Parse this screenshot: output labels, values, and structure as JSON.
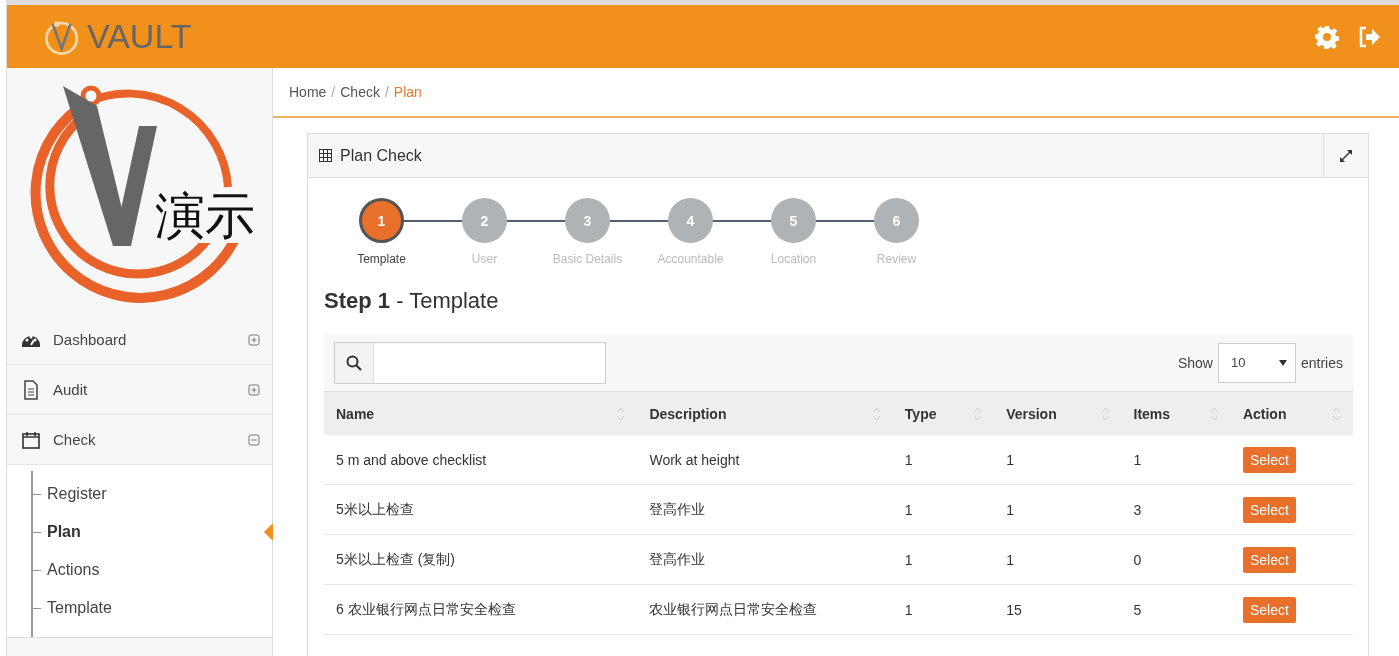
{
  "header": {
    "brand": "VAULT"
  },
  "sidebar": {
    "logo_text": "演示",
    "items": [
      {
        "label": "Dashboard",
        "expanded": false
      },
      {
        "label": "Audit",
        "expanded": false
      },
      {
        "label": "Check",
        "expanded": true,
        "children": [
          {
            "label": "Register",
            "selected": false
          },
          {
            "label": "Plan",
            "selected": true
          },
          {
            "label": "Actions",
            "selected": false
          },
          {
            "label": "Template",
            "selected": false
          }
        ]
      }
    ]
  },
  "breadcrumb": [
    {
      "label": "Home",
      "current": false
    },
    {
      "separator": "/",
      "label": "Check",
      "current": false
    },
    {
      "separator": "/",
      "label": "Plan",
      "current": true
    }
  ],
  "panel": {
    "title": "Plan Check",
    "steps": [
      {
        "number": "1",
        "label": "Template",
        "selected": true
      },
      {
        "number": "2",
        "label": "User",
        "selected": false
      },
      {
        "number": "3",
        "label": "Basic Details",
        "selected": false
      },
      {
        "number": "4",
        "label": "Accountable",
        "selected": false
      },
      {
        "number": "5",
        "label": "Location",
        "selected": false
      },
      {
        "number": "6",
        "label": "Review",
        "selected": false
      }
    ],
    "step_heading": "**Step 1** - Template",
    "show_label": "Show",
    "page_size": "10",
    "entries_label": "entries",
    "table": {
      "columns": [
        "Name",
        "Description",
        "Type",
        "Version",
        "Items",
        "Action"
      ],
      "rows": [
        {
          "cells": [
            "5 m and above checklist",
            "Work at height",
            "1",
            "1",
            "1"
          ],
          "action": "Select"
        },
        {
          "cells": [
            "5米以上检查",
            "登高作业",
            "1",
            "1",
            "3"
          ],
          "action": "Select"
        },
        {
          "cells": [
            "5米以上检查 (复制)",
            "登高作业",
            "1",
            "1",
            "0"
          ],
          "action": "Select"
        },
        {
          "cells": [
            "6 农业银行网点日常安全检查",
            "农业银行网点日常安全检查",
            "1",
            "15",
            "5"
          ],
          "action": "Select"
        }
      ]
    }
  }
}
